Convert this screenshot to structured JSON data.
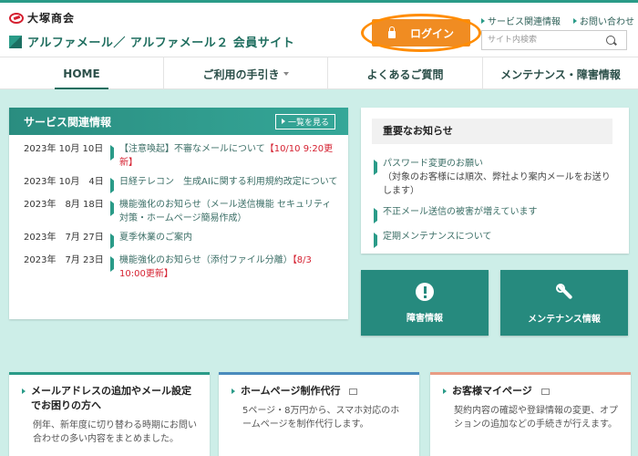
{
  "header": {
    "company": "大塚商会",
    "site_title": "アルファメール／ アルファメール２ 会員サイト",
    "login_label": "ログイン",
    "util_links": [
      "サービス関連情報",
      "お問い合わせ"
    ],
    "search_placeholder": "サイト内検索"
  },
  "nav": [
    {
      "label": "HOME",
      "active": true
    },
    {
      "label": "ご利用の手引き",
      "dropdown": true
    },
    {
      "label": "よくあるご質問"
    },
    {
      "label": "メンテナンス・障害情報"
    }
  ],
  "service": {
    "title": "サービス関連情報",
    "more_label": "一覧を見る",
    "items": [
      {
        "date": "2023年 10月 10日",
        "text": "【注意喚起】不審なメールについて",
        "red": "【10/10 9:20更新】"
      },
      {
        "date": "2023年 10月　4日",
        "text": "日経テレコン　生成AIに関する利用規約改定について",
        "red": ""
      },
      {
        "date": "2023年　8月 18日",
        "text": "機能強化のお知らせ（メール送信機能 セキュリティ対策・ホームページ簡易作成）",
        "red": ""
      },
      {
        "date": "2023年　7月 27日",
        "text": "夏季休業のご案内",
        "red": ""
      },
      {
        "date": "2023年　7月 23日",
        "text": "機能強化のお知らせ（添付ファイル分離）",
        "red": "【8/3 10:00更新】"
      }
    ]
  },
  "notice": {
    "title": "重要なお知らせ",
    "items": [
      {
        "text": "パスワード変更のお願い",
        "sub": "（対象のお客様には順次、弊社より案内メールをお送りします）"
      },
      {
        "text": "不正メール送信の被害が増えています",
        "sub": ""
      },
      {
        "text": "定期メンテナンスについて",
        "sub": ""
      }
    ]
  },
  "tiles": [
    {
      "label": "障害情報",
      "icon": "alert-icon"
    },
    {
      "label": "メンテナンス情報",
      "icon": "wrench-icon"
    }
  ],
  "cards": [
    {
      "title": "メールアドレスの追加やメール設定でお困りの方へ",
      "desc": "例年、新年度に切り替わる時期にお問い合わせの多い内容をまとめました。"
    },
    {
      "title": "ホームページ制作代行",
      "desc": "5ページ・8万円から、スマホ対応のホームページを制作代行します。"
    },
    {
      "title": "お客様マイページ",
      "desc": "契約内容の確認や登録情報の変更、オプションの追加などの手続きが行えます。"
    }
  ]
}
